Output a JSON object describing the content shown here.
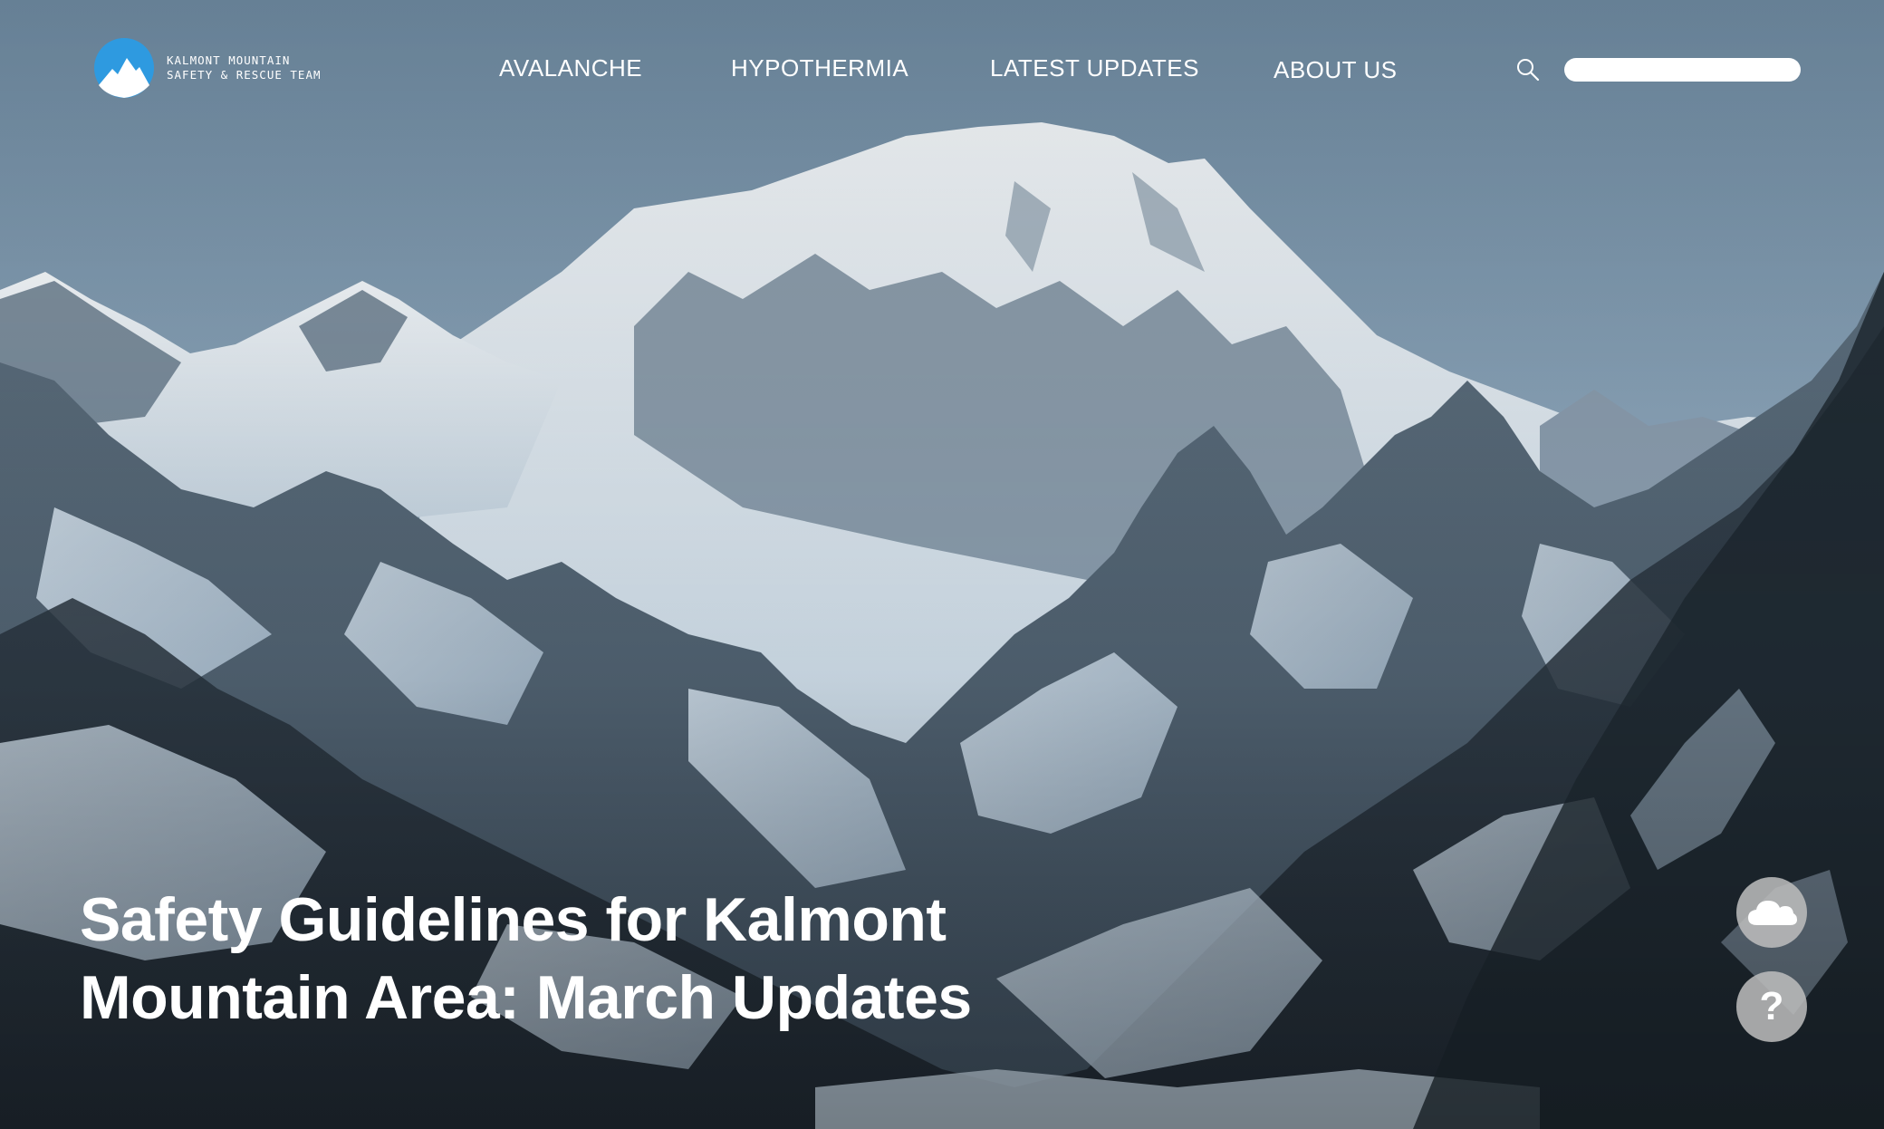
{
  "brand": {
    "line1": "KALMONT MOUNTAIN",
    "line2": "SAFETY & RESCUE TEAM",
    "logo_icon": "mountain-logo-icon",
    "logo_color": "#2e9ae0"
  },
  "nav": {
    "items": [
      {
        "label": "AVALANCHE"
      },
      {
        "label": "HYPOTHERMIA"
      },
      {
        "label": "LATEST UPDATES"
      },
      {
        "label": "ABOUT US"
      }
    ]
  },
  "search": {
    "icon": "search-icon",
    "value": "",
    "placeholder": ""
  },
  "hero": {
    "headline_line1": "Safety Guidelines for Kalmont",
    "headline_line2": "Mountain Area: March Updates"
  },
  "floating_buttons": {
    "weather_icon": "cloud-icon",
    "help_label": "?"
  },
  "colors": {
    "sky": "#8ea6ba",
    "rock_dark": "#1d2730",
    "snow": "#dde6ee"
  }
}
